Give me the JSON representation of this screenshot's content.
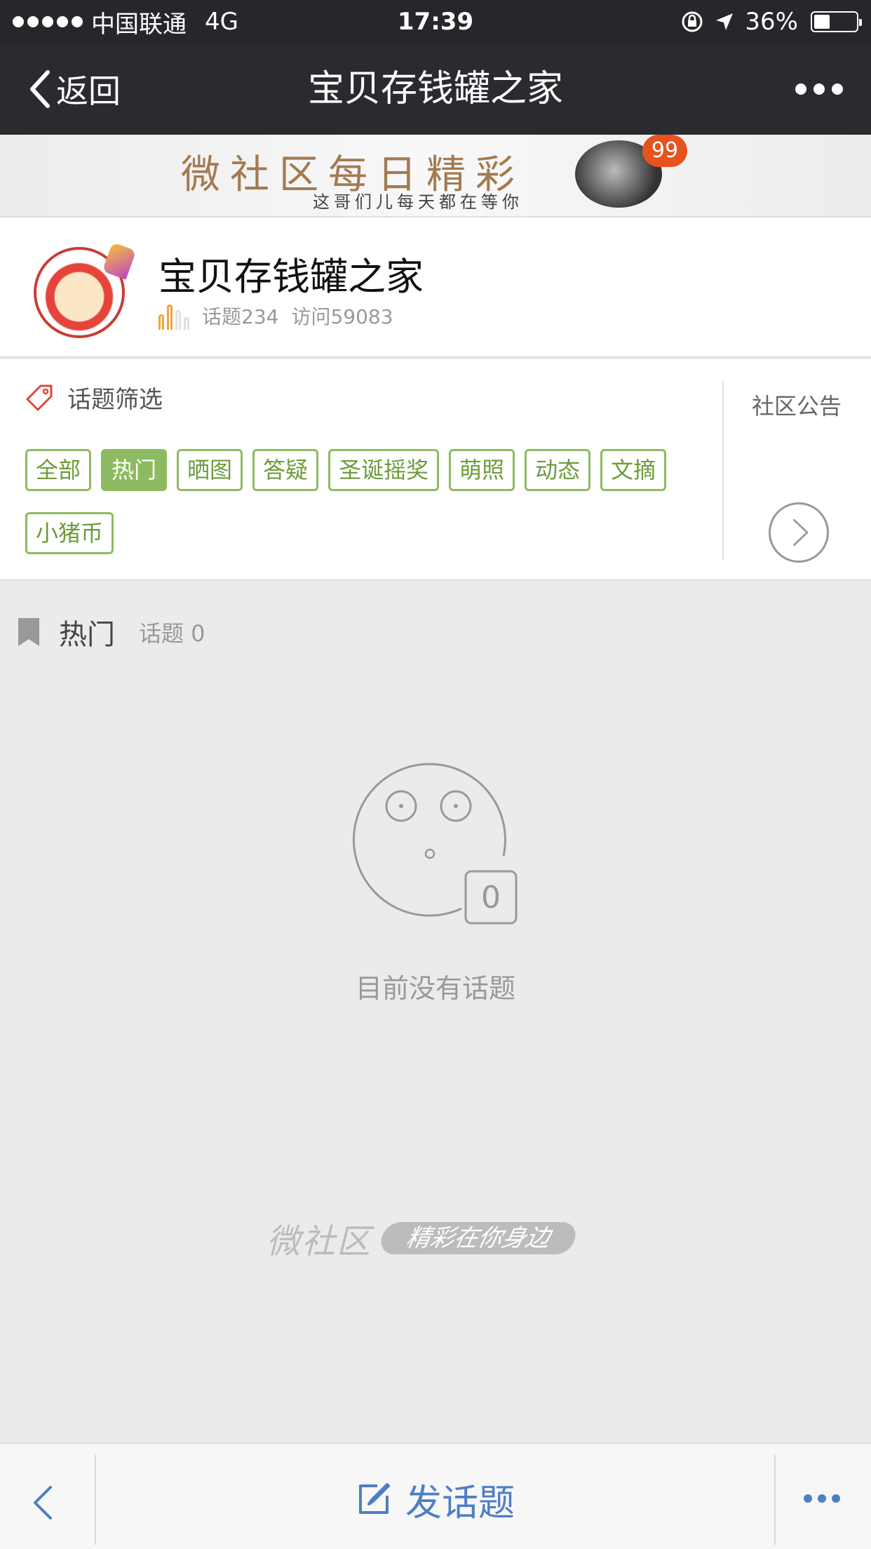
{
  "status_bar": {
    "carrier": "中国联通",
    "network": "4G",
    "time": "17:39",
    "battery": "36%"
  },
  "nav": {
    "back_label": "返回",
    "title": "宝贝存钱罐之家"
  },
  "banner": {
    "title": "微社区每日精彩",
    "subtitle": "这哥们儿每天都在等你",
    "badge": "99"
  },
  "community": {
    "name": "宝贝存钱罐之家",
    "topics": "话题234",
    "visits": "访问59083"
  },
  "filter": {
    "heading": "话题筛选",
    "tags": [
      "全部",
      "热门",
      "晒图",
      "答疑",
      "圣诞摇奖",
      "萌照",
      "动态",
      "文摘",
      "小猪币"
    ],
    "active_tag": "热门",
    "notice_label": "社区公告"
  },
  "section": {
    "title": "热门",
    "count": "话题 0"
  },
  "empty": {
    "message": "目前没有话题",
    "face_digit": "0"
  },
  "footer": {
    "logo_text": "微社区",
    "slogan": "精彩在你身边"
  },
  "bottom_bar": {
    "post_label": "发话题"
  },
  "colors": {
    "accent_green": "#8dbb61",
    "link_blue": "#4d7fc4",
    "nav_bg": "#2a2b2f",
    "badge_red": "#e6531f"
  }
}
